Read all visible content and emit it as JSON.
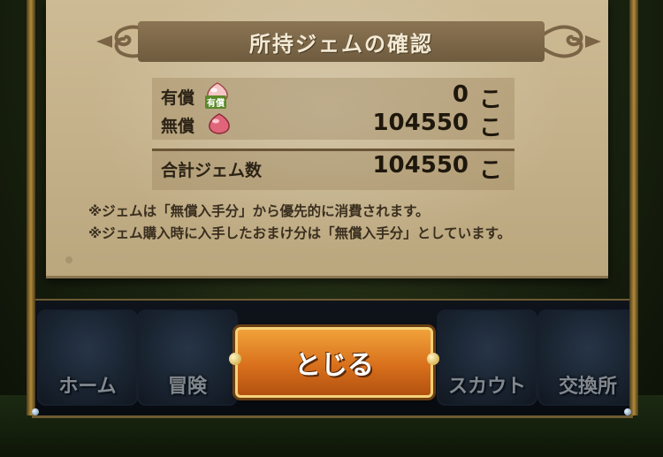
{
  "dialog": {
    "title": "所持ジェムの確認",
    "rows": [
      {
        "label": "有償",
        "badge": "有償",
        "value": "0",
        "unit": "こ",
        "icon": "paid-gem-icon"
      },
      {
        "label": "無償",
        "value": "104550",
        "unit": "こ",
        "icon": "free-gem-icon"
      }
    ],
    "total": {
      "label": "合計ジェム数",
      "value": "104550",
      "unit": "こ"
    },
    "notes": [
      "※ジェムは「無償入手分」から優先的に消費されます。",
      "※ジェム購入時に入手したおまけ分は「無償入手分」としています。"
    ],
    "close_label": "とじる"
  },
  "nav": {
    "items": [
      {
        "label": "ホーム"
      },
      {
        "label": "冒険"
      },
      {
        "label": "スカウト"
      },
      {
        "label": "交換所"
      }
    ]
  },
  "colors": {
    "parchment": "#c9b68f",
    "banner": "#7d6749",
    "button": "#e38a2a",
    "button_border": "#f5d27a"
  }
}
